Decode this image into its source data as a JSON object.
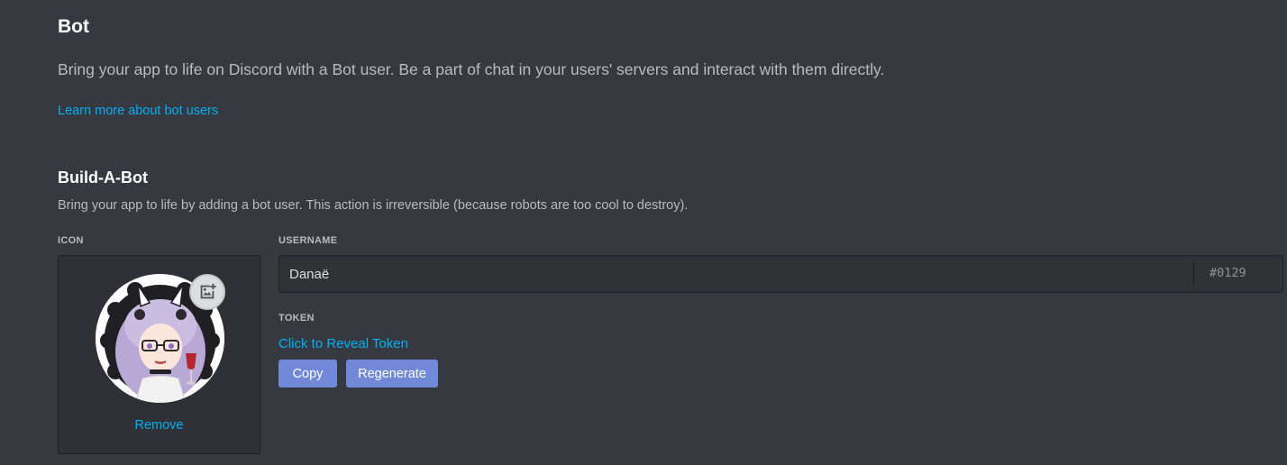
{
  "header": {
    "title": "Bot",
    "description": "Bring your app to life on Discord with a Bot user. Be a part of chat in your users' servers and interact with them directly.",
    "learn_more_link": "Learn more about bot users"
  },
  "build_a_bot": {
    "title": "Build-A-Bot",
    "description": "Bring your app to life by adding a bot user. This action is irreversible (because robots are too cool to destroy).",
    "icon": {
      "label": "ICON",
      "remove_link": "Remove",
      "upload_icon": "image-add-icon"
    },
    "username": {
      "label": "USERNAME",
      "value": "Danaë",
      "discriminator": "#0129"
    },
    "token": {
      "label": "TOKEN",
      "reveal_link": "Click to Reveal Token",
      "copy_button": "Copy",
      "regenerate_button": "Regenerate"
    }
  },
  "colors": {
    "background": "#363940",
    "link": "#00b0f4",
    "button": "#7289da",
    "input_bg": "#303236"
  }
}
